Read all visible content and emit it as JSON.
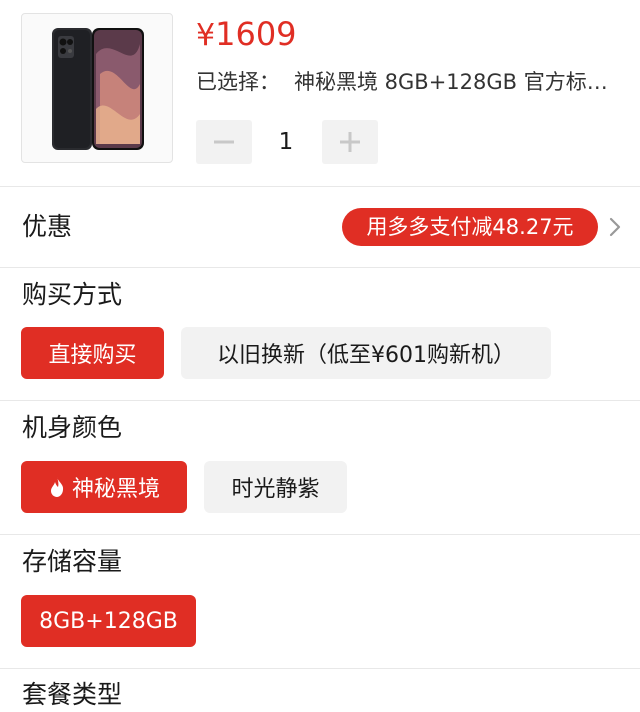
{
  "product": {
    "price_symbol": "¥",
    "price_value": "1609",
    "selected_prefix": "已选择：",
    "selected_value": "神秘黑境 8GB+128GB 官方标…",
    "quantity": "1",
    "minus_label": "−",
    "plus_label": "+"
  },
  "promo": {
    "label": "优惠",
    "badge": "用多多支付减48.27元"
  },
  "purchase_method": {
    "label": "购买方式",
    "options": [
      "直接购买",
      "以旧换新（低至¥601购新机）"
    ],
    "selected": "直接购买"
  },
  "color": {
    "label": "机身颜色",
    "options": [
      "神秘黑境",
      "时光静紫"
    ],
    "selected": "神秘黑境",
    "hot_icon": "flame-icon"
  },
  "storage": {
    "label": "存储容量",
    "options": [
      "8GB+128GB"
    ],
    "selected": "8GB+128GB"
  },
  "package": {
    "label": "套餐类型"
  },
  "colors": {
    "accent": "#e02e24",
    "option_bg": "#f2f2f2",
    "divider": "#e8e8e8"
  }
}
